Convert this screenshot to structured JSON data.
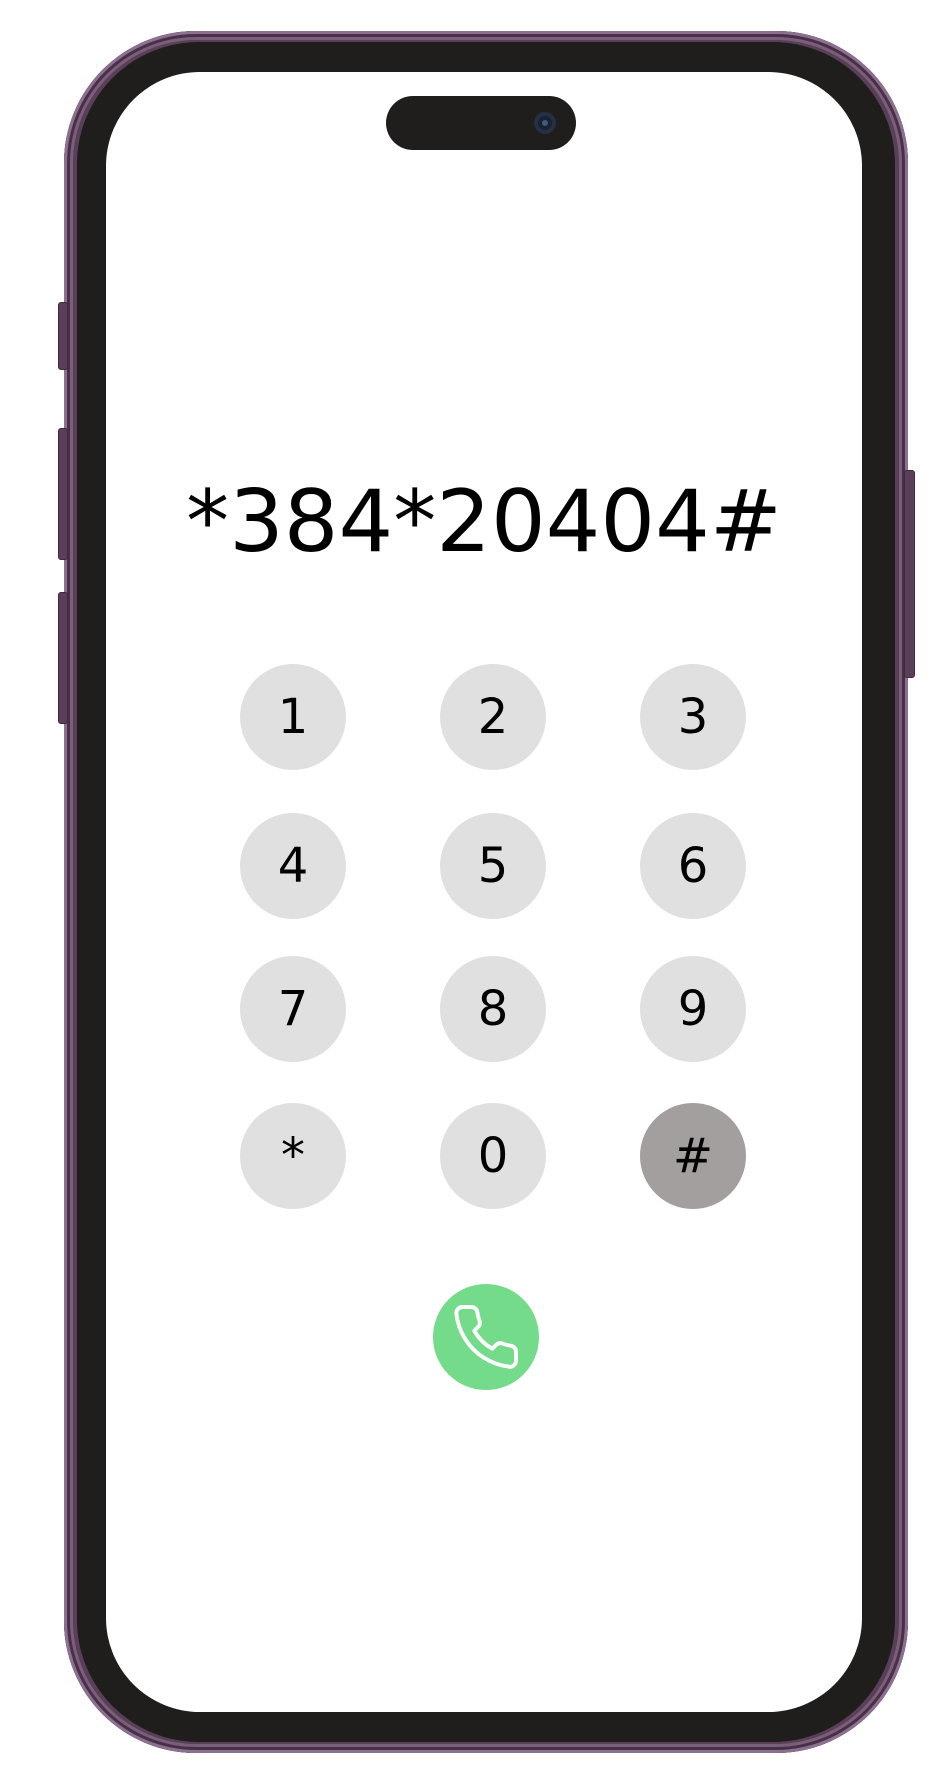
{
  "device": {
    "frame_color": "#5b3f59",
    "bezel_color": "#1f1e1c",
    "screen_color": "#ffffff"
  },
  "dialer": {
    "number": "*384*20404#",
    "keys": [
      {
        "label": "1"
      },
      {
        "label": "2"
      },
      {
        "label": "3"
      },
      {
        "label": "4"
      },
      {
        "label": "5"
      },
      {
        "label": "6"
      },
      {
        "label": "7"
      },
      {
        "label": "8"
      },
      {
        "label": "9"
      },
      {
        "label": "*"
      },
      {
        "label": "0"
      },
      {
        "label": "#",
        "state": "pressed"
      }
    ],
    "key_color": "#e0e0e0",
    "pressed_key_color": "#a39f9f",
    "call_button": {
      "icon": "phone-icon",
      "color": "#74db8a"
    }
  }
}
